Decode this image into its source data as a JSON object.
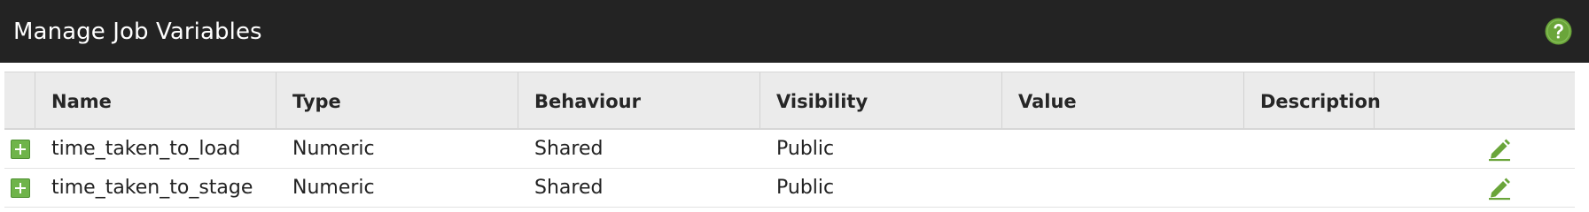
{
  "header": {
    "title": "Manage Job Variables",
    "help_icon": "help-icon",
    "help_color": "#6aa53a"
  },
  "table": {
    "columns": [
      "Name",
      "Type",
      "Behaviour",
      "Visibility",
      "Value",
      "Description"
    ],
    "rows": [
      {
        "name": "time_taken_to_load",
        "type": "Numeric",
        "behaviour": "Shared",
        "visibility": "Public",
        "value": "",
        "description_icon": "edit-icon"
      },
      {
        "name": "time_taken_to_stage",
        "type": "Numeric",
        "behaviour": "Shared",
        "visibility": "Public",
        "value": "",
        "description_icon": "edit-icon"
      }
    ],
    "row_icon": "expand-plus-icon",
    "accent_color": "#6fb44a"
  }
}
